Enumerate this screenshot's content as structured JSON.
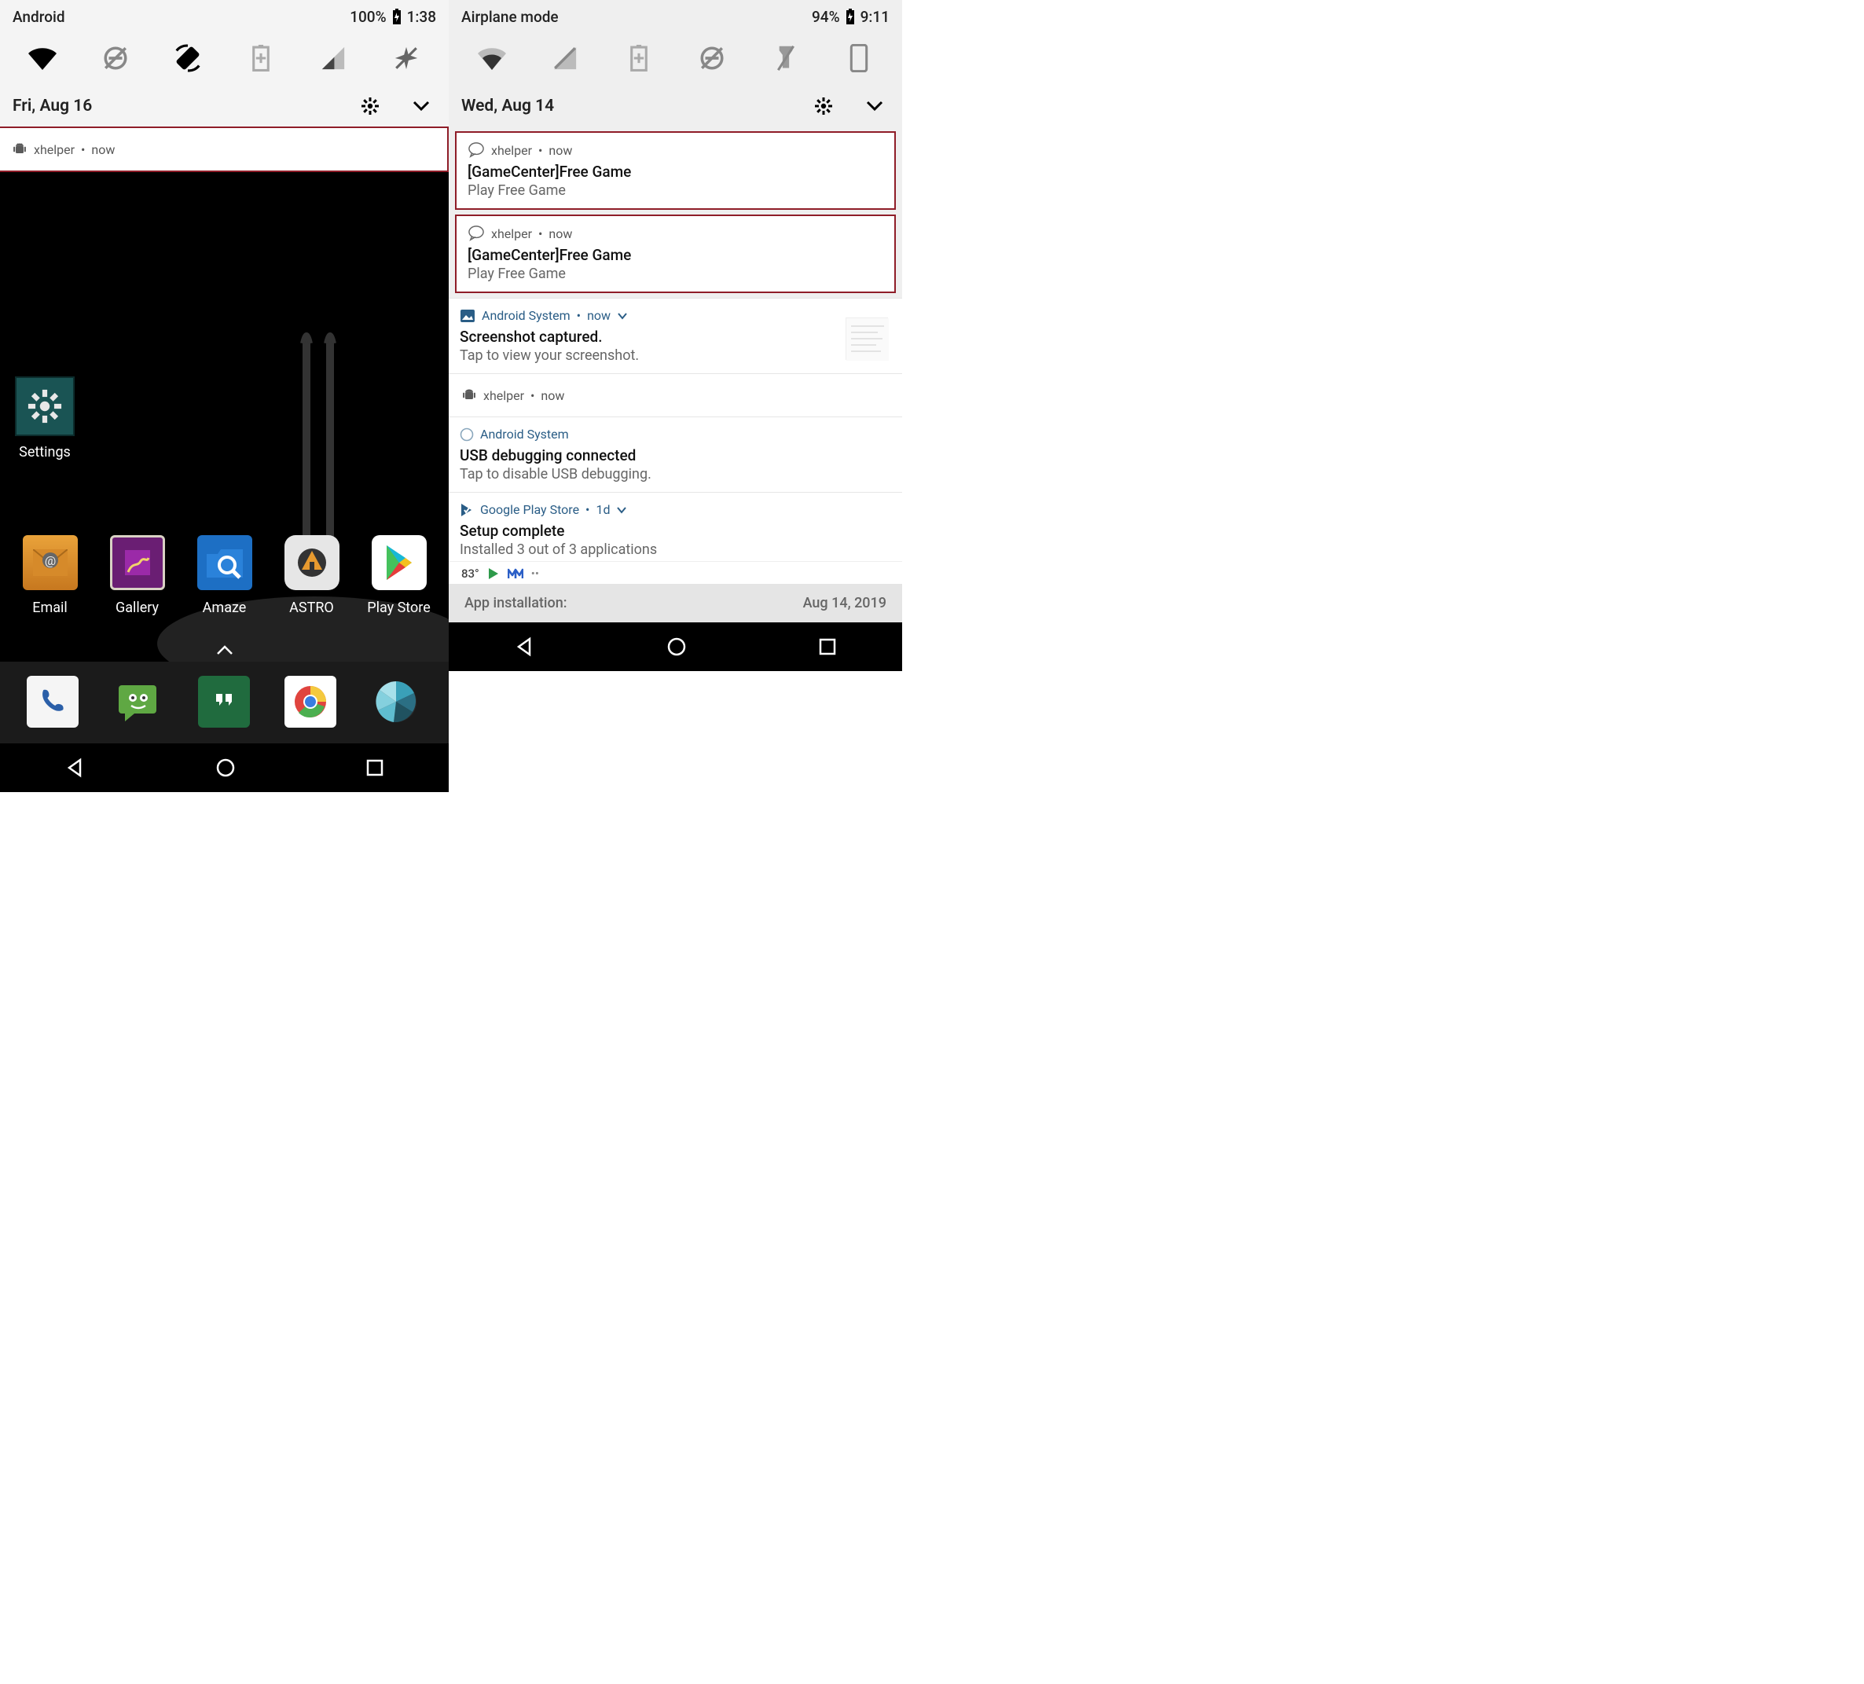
{
  "left": {
    "status": {
      "title": "Android",
      "battery": "100%",
      "time": "1:38"
    },
    "date": "Fri, Aug 16",
    "notif1": {
      "app": "xhelper",
      "time": "now"
    },
    "apps": {
      "settings": "Settings",
      "rowLabels": [
        "Email",
        "Gallery",
        "Amaze",
        "ASTRO",
        "Play Store"
      ]
    }
  },
  "right": {
    "status": {
      "title": "Airplane mode",
      "battery": "94%",
      "time": "9:11"
    },
    "date": "Wed, Aug 14",
    "n1": {
      "app": "xhelper",
      "time": "now",
      "title": "[GameCenter]Free Game",
      "body": "Play Free Game"
    },
    "n2": {
      "app": "xhelper",
      "time": "now",
      "title": "[GameCenter]Free Game",
      "body": "Play Free Game"
    },
    "n3": {
      "app": "Android System",
      "time": "now",
      "title": "Screenshot captured.",
      "body": "Tap to view your screenshot."
    },
    "n4": {
      "app": "xhelper",
      "time": "now"
    },
    "n5": {
      "app": "Android System",
      "title": "USB debugging connected",
      "body": "Tap to disable USB debugging."
    },
    "n6": {
      "app": "Google Play Store",
      "time": "1d",
      "title": "Setup complete",
      "body": "Installed 3 out of 3 applications"
    },
    "mini": {
      "temp": "83°"
    },
    "dim": {
      "label": "App installation:",
      "date": "Aug 14, 2019"
    }
  }
}
